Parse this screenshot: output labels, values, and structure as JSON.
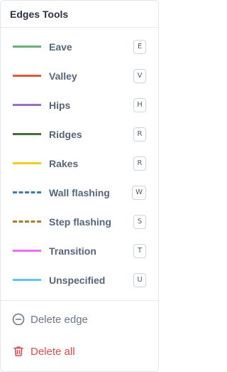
{
  "header": {
    "title": "Edges Tools"
  },
  "tools": [
    {
      "label": "Eave",
      "shortcut": "E",
      "color": "#6aaf7a",
      "style": "solid"
    },
    {
      "label": "Valley",
      "shortcut": "V",
      "color": "#e2583c",
      "style": "solid"
    },
    {
      "label": "Hips",
      "shortcut": "H",
      "color": "#9c6dc1",
      "style": "solid"
    },
    {
      "label": "Ridges",
      "shortcut": "R",
      "color": "#4a6b3b",
      "style": "solid"
    },
    {
      "label": "Rakes",
      "shortcut": "R",
      "color": "#f4cc1f",
      "style": "solid"
    },
    {
      "label": "Wall flashing",
      "shortcut": "W",
      "color": "#3d7ea6",
      "style": "dashed"
    },
    {
      "label": "Step flashing",
      "shortcut": "S",
      "color": "#a97e2c",
      "style": "dashed"
    },
    {
      "label": "Transition",
      "shortcut": "T",
      "color": "#ee6ef0",
      "style": "solid"
    },
    {
      "label": "Unspecified",
      "shortcut": "U",
      "color": "#5ac8ef",
      "style": "solid"
    }
  ],
  "actions": {
    "delete_edge": {
      "label": "Delete edge",
      "icon": "minus-circle-icon"
    },
    "delete_all": {
      "label": "Delete all",
      "icon": "trash-icon",
      "color": "#e5484d"
    }
  }
}
